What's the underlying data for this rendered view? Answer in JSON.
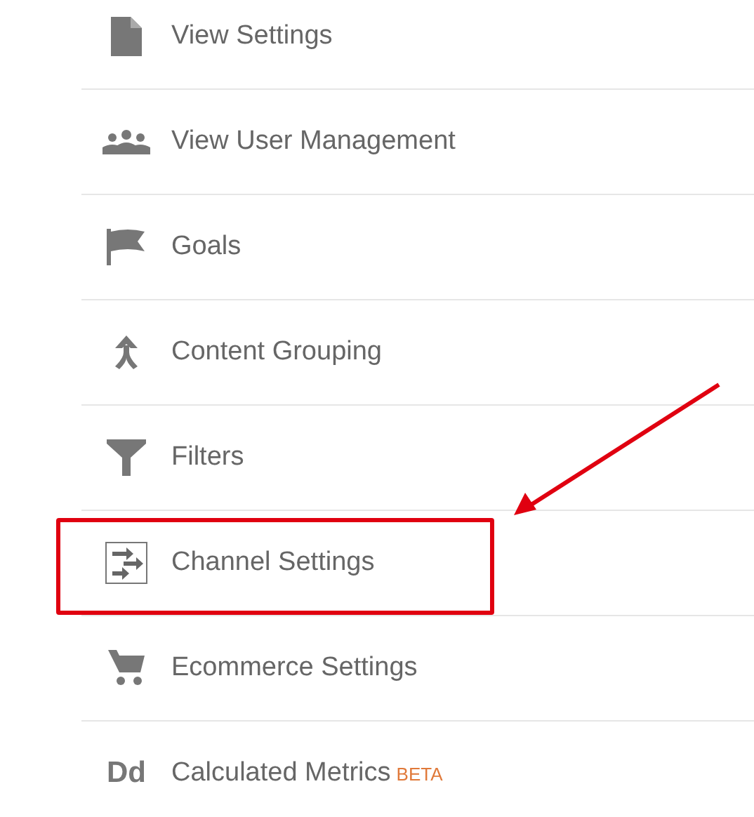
{
  "menu": {
    "items": [
      {
        "label": "View Settings",
        "kind": "document",
        "highlighted": false
      },
      {
        "label": "View User Management",
        "kind": "people",
        "highlighted": false
      },
      {
        "label": "Goals",
        "kind": "flag",
        "highlighted": false
      },
      {
        "label": "Content Grouping",
        "kind": "merge",
        "highlighted": false
      },
      {
        "label": "Filters",
        "kind": "funnel",
        "highlighted": false
      },
      {
        "label": "Channel Settings",
        "kind": "channel",
        "highlighted": true
      },
      {
        "label": "Ecommerce Settings",
        "kind": "cart",
        "highlighted": false
      },
      {
        "label": "Calculated Metrics",
        "kind": "glyph",
        "glyph": "Dd",
        "badge": "BETA",
        "highlighted": false
      }
    ]
  }
}
